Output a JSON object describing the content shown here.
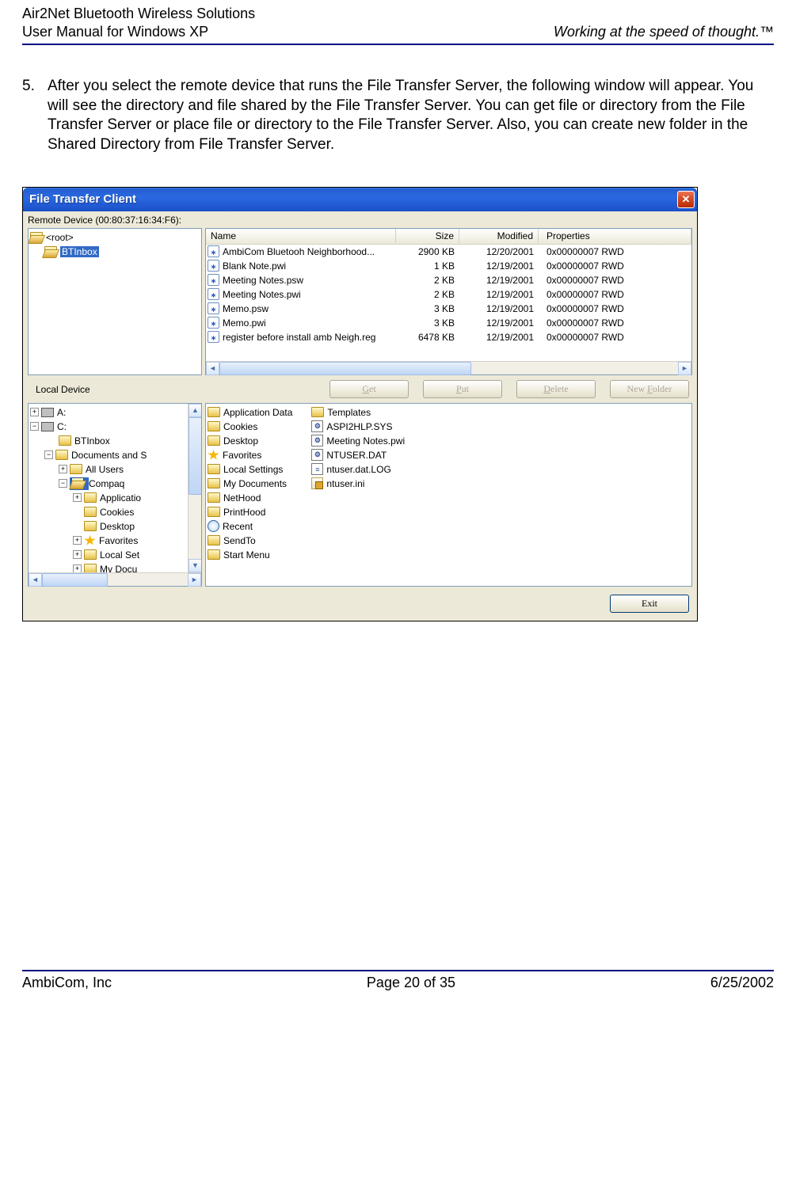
{
  "doc_header": {
    "line1": "Air2Net Bluetooth Wireless Solutions",
    "line2": "User Manual for Windows XP",
    "tagline": "Working at the speed of thought.™"
  },
  "step": {
    "number": "5.",
    "text": "After you select the remote device that runs the File Transfer Server, the following window will appear. You will see the directory and file shared by the File Transfer Server. You can get file or directory from the File Transfer Server or place file or directory to the File Transfer Server. Also, you can create new folder in the Shared Directory from File Transfer Server."
  },
  "window": {
    "title": "File Transfer Client",
    "remote_label": "Remote Device (00:80:37:16:34:F6):",
    "tree_root": "<root>",
    "tree_selected": "BTInbox",
    "columns": {
      "name": "Name",
      "size": "Size",
      "modified": "Modified",
      "properties": "Properties"
    },
    "remote_files": [
      {
        "name": "AmbiCom Bluetooh Neighborhood...",
        "size": "2900 KB",
        "mod": "12/20/2001",
        "prop": "0x00000007 RWD"
      },
      {
        "name": "Blank Note.pwi",
        "size": "1 KB",
        "mod": "12/19/2001",
        "prop": "0x00000007 RWD"
      },
      {
        "name": "Meeting Notes.psw",
        "size": "2 KB",
        "mod": "12/19/2001",
        "prop": "0x00000007 RWD"
      },
      {
        "name": "Meeting Notes.pwi",
        "size": "2 KB",
        "mod": "12/19/2001",
        "prop": "0x00000007 RWD"
      },
      {
        "name": "Memo.psw",
        "size": "3 KB",
        "mod": "12/19/2001",
        "prop": "0x00000007 RWD"
      },
      {
        "name": "Memo.pwi",
        "size": "3 KB",
        "mod": "12/19/2001",
        "prop": "0x00000007 RWD"
      },
      {
        "name": "register before install amb Neigh.reg",
        "size": "6478 KB",
        "mod": "12/19/2001",
        "prop": "0x00000007 RWD"
      }
    ],
    "buttons": {
      "get": "Get",
      "put": "Put",
      "delete": "Delete",
      "newfolder": "New Folder",
      "exit": "Exit"
    },
    "local_label": "Local Device",
    "local_tree": {
      "drive_a": "A:",
      "drive_c": "C:",
      "btinbox": "BTInbox",
      "docs": "Documents and S",
      "allusers": "All Users",
      "compaq": "Compaq",
      "applicatio": "Applicatio",
      "cookies": "Cookies",
      "desktop": "Desktop",
      "favorites": "Favorites",
      "localset": "Local Set",
      "mydocu": "My Docu"
    },
    "local_files_col1": [
      {
        "t": "folder",
        "n": "Application Data"
      },
      {
        "t": "folder",
        "n": "Cookies"
      },
      {
        "t": "folder",
        "n": "Desktop"
      },
      {
        "t": "fav",
        "n": "Favorites"
      },
      {
        "t": "folder",
        "n": "Local Settings"
      },
      {
        "t": "folder",
        "n": "My Documents"
      },
      {
        "t": "folder",
        "n": "NetHood"
      },
      {
        "t": "folder",
        "n": "PrintHood"
      },
      {
        "t": "recent",
        "n": "Recent"
      },
      {
        "t": "folder",
        "n": "SendTo"
      },
      {
        "t": "folder",
        "n": "Start Menu"
      }
    ],
    "local_files_col2": [
      {
        "t": "folder",
        "n": "Templates"
      },
      {
        "t": "sys",
        "n": "ASPI2HLP.SYS"
      },
      {
        "t": "sys",
        "n": "Meeting Notes.pwi"
      },
      {
        "t": "sys",
        "n": "NTUSER.DAT"
      },
      {
        "t": "txt",
        "n": "ntuser.dat.LOG"
      },
      {
        "t": "ini",
        "n": "ntuser.ini"
      }
    ]
  },
  "footer": {
    "left": "AmbiCom, Inc",
    "center": "Page 20 of 35",
    "right": "6/25/2002"
  }
}
